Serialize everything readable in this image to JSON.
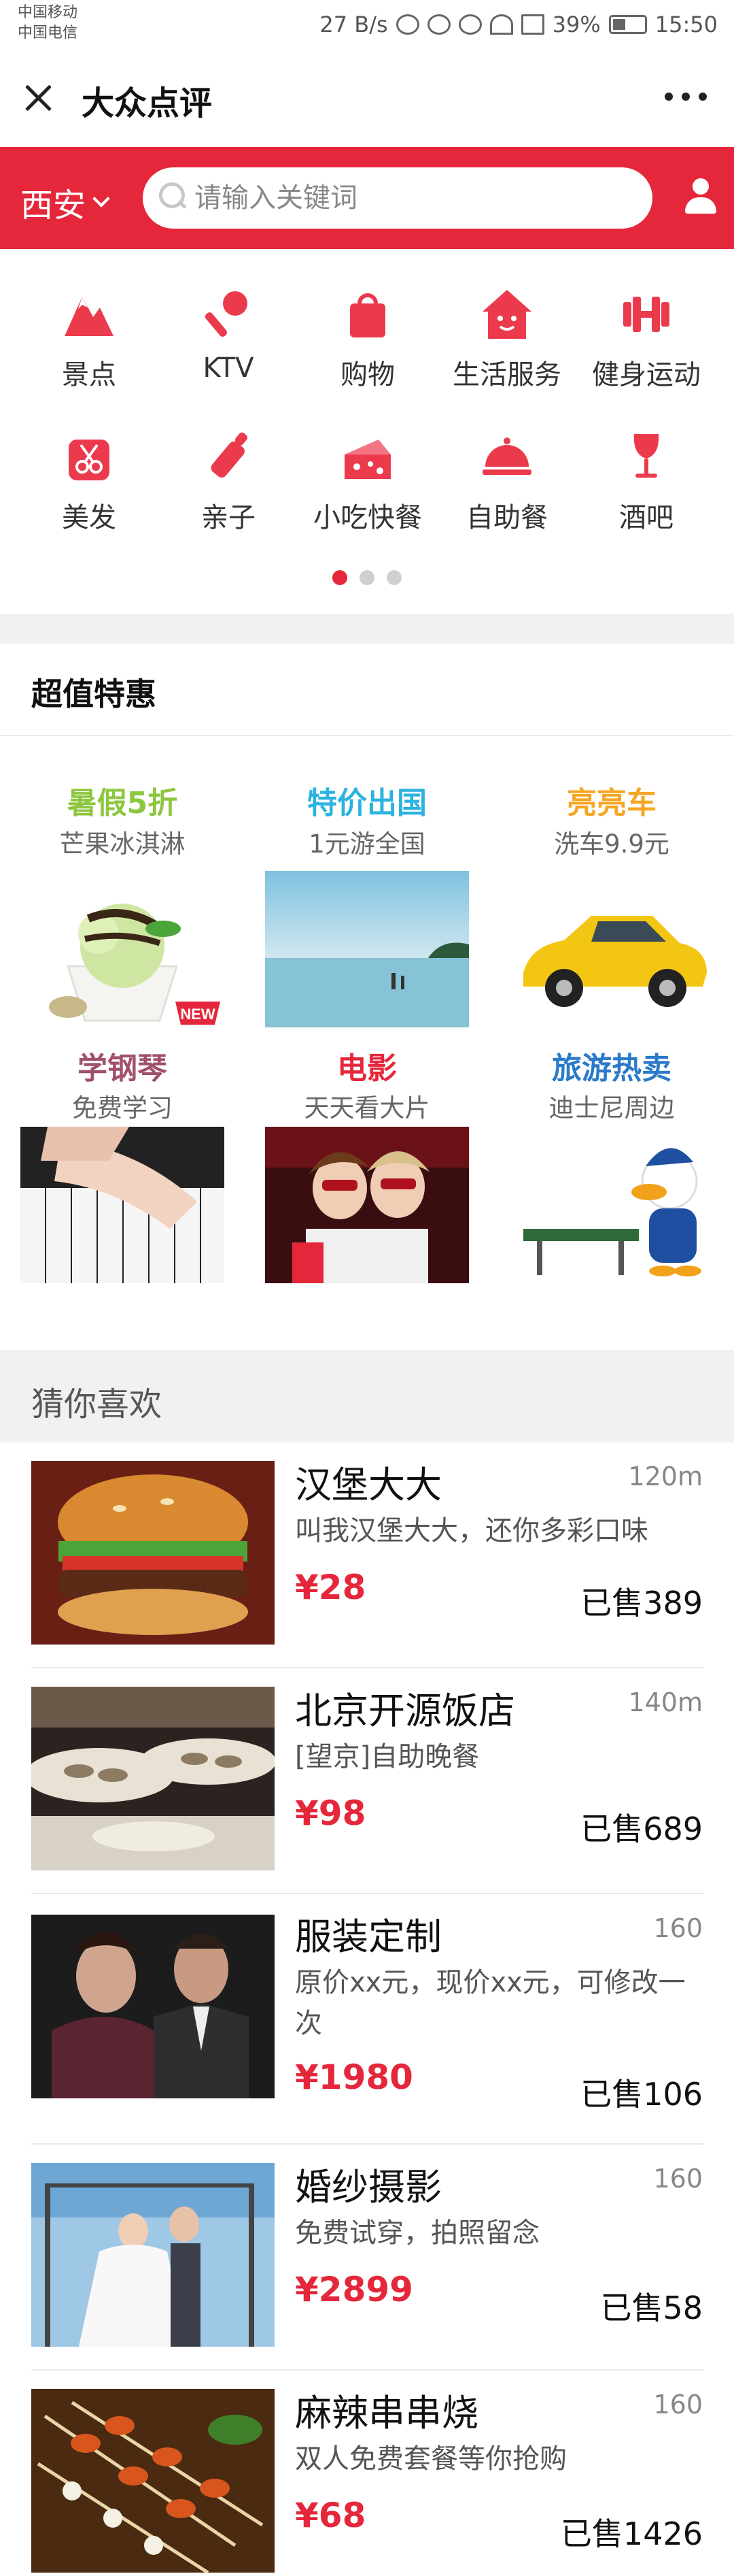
{
  "status_bar": {
    "carrier1": "中国移动",
    "carrier2": "中国电信",
    "net_speed": "27 B/s",
    "battery": "39%",
    "time": "15:50"
  },
  "title_bar": {
    "title": "大众点评"
  },
  "search": {
    "city": "西安",
    "placeholder": "请输入关键词"
  },
  "categories": [
    {
      "label": "景点",
      "icon": "mountain-icon"
    },
    {
      "label": "KTV",
      "icon": "microphone-icon"
    },
    {
      "label": "购物",
      "icon": "shopping-bag-icon"
    },
    {
      "label": "生活服务",
      "icon": "house-icon"
    },
    {
      "label": "健身运动",
      "icon": "dumbbell-icon"
    },
    {
      "label": "美发",
      "icon": "scissors-icon"
    },
    {
      "label": "亲子",
      "icon": "baby-bottle-icon"
    },
    {
      "label": "小吃快餐",
      "icon": "cheese-icon"
    },
    {
      "label": "自助餐",
      "icon": "food-cloche-icon"
    },
    {
      "label": "酒吧",
      "icon": "wine-glass-icon"
    }
  ],
  "deals": {
    "title": "超值特惠",
    "items": [
      {
        "title": "暑假5折",
        "subtitle": "芒果冰淇淋",
        "color": "#8dc63f",
        "badge": "NEW"
      },
      {
        "title": "特价出国",
        "subtitle": "1元游全国",
        "color": "#2bb3e0"
      },
      {
        "title": "亮亮车",
        "subtitle": "洗车9.9元",
        "color": "#f5a623"
      },
      {
        "title": "学钢琴",
        "subtitle": "免费学习",
        "color": "#a0506a"
      },
      {
        "title": "电影",
        "subtitle": "天天看大片",
        "color": "#e5273b"
      },
      {
        "title": "旅游热卖",
        "subtitle": "迪士尼周边",
        "color": "#2a7ac9"
      }
    ]
  },
  "guess": {
    "title": "猜你喜欢",
    "items": [
      {
        "name": "汉堡大大",
        "distance": "120m",
        "desc": "叫我汉堡大大，还你多彩口味",
        "price": "¥28",
        "sold": "已售389"
      },
      {
        "name": "北京开源饭店",
        "distance": "140m",
        "desc": "[望京]自助晚餐",
        "price": "¥98",
        "sold": "已售689"
      },
      {
        "name": "服装定制",
        "distance": "160",
        "desc": "原价xx元，现价xx元，可修改一次",
        "price": "¥1980",
        "sold": "已售106"
      },
      {
        "name": "婚纱摄影",
        "distance": "160",
        "desc": "免费试穿，拍照留念",
        "price": "¥2899",
        "sold": "已售58"
      },
      {
        "name": "麻辣串串烧",
        "distance": "160",
        "desc": "双人免费套餐等你抢购",
        "price": "¥68",
        "sold": "已售1426"
      }
    ]
  },
  "colors": {
    "brand_red": "#e5273b"
  }
}
